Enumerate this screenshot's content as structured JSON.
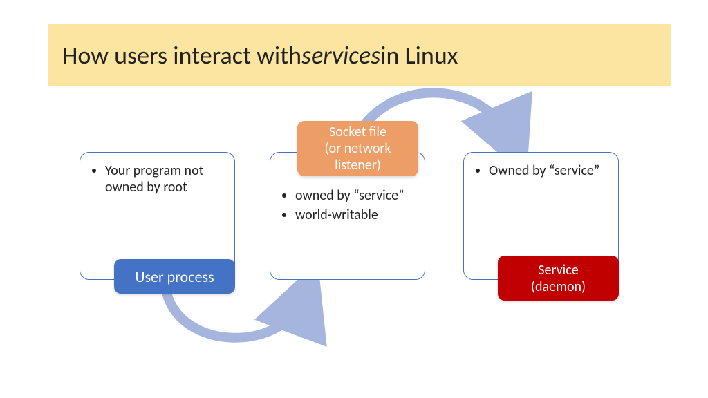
{
  "title": {
    "pre": "How users interact with ",
    "italic": "services",
    "post": " in Linux"
  },
  "boxes": {
    "user_process": {
      "label": "User process",
      "bullets": [
        "Your program not owned by root"
      ]
    },
    "socket_file": {
      "label_line1": "Socket file",
      "label_line2": "(or network listener)",
      "bullets": [
        "owned by “service”",
        "world-writable"
      ]
    },
    "service": {
      "label_line1": "Service",
      "label_line2": "(daemon)",
      "bullets": [
        "Owned by “service”"
      ]
    }
  },
  "colors": {
    "title_bg": "#FCE5A1",
    "border": "#4472C4",
    "arrow": "#A6B5DE",
    "badge_blue": "#4472C4",
    "badge_orange": "#ED9E66",
    "badge_red": "#C00000"
  }
}
